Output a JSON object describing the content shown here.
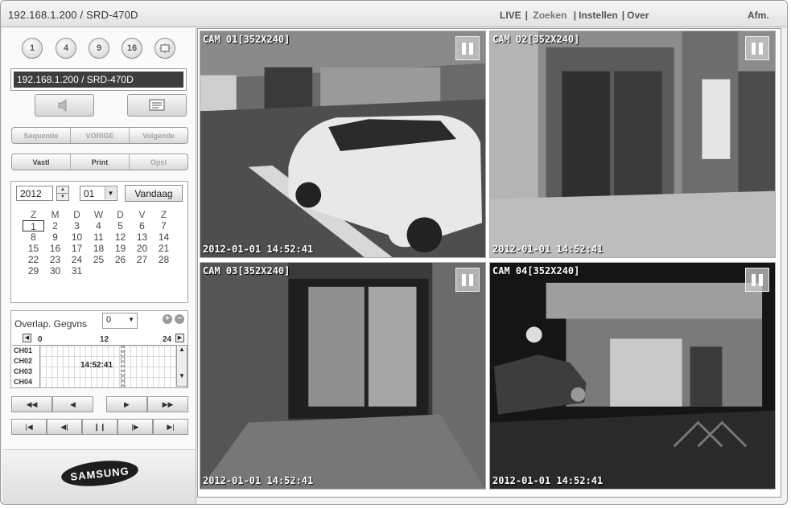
{
  "header": {
    "title": "192.168.1.200 / SRD-470D",
    "nav": {
      "live": "LIVE",
      "search": "Zoeken",
      "settings": "Instellen",
      "about": "Over"
    },
    "logout": "Afm."
  },
  "sidebar": {
    "split_buttons": [
      "1",
      "4",
      "9",
      "16"
    ],
    "device_label": "192.168.1.200   / SRD-470D",
    "seq_bar": [
      "Sequentie",
      "VORIGE",
      "Volgende"
    ],
    "action_bar": [
      "Vastl",
      "Print",
      "Opsl"
    ],
    "calendar": {
      "year": "2012",
      "month": "01",
      "today_label": "Vandaag",
      "weekdays": [
        "Z",
        "M",
        "D",
        "W",
        "D",
        "V",
        "Z"
      ],
      "weeks": [
        [
          "1",
          "2",
          "3",
          "4",
          "5",
          "6",
          "7"
        ],
        [
          "8",
          "9",
          "10",
          "11",
          "12",
          "13",
          "14"
        ],
        [
          "15",
          "16",
          "17",
          "18",
          "19",
          "20",
          "21"
        ],
        [
          "22",
          "23",
          "24",
          "25",
          "26",
          "27",
          "28"
        ],
        [
          "29",
          "30",
          "31",
          "",
          "",
          "",
          ""
        ]
      ],
      "selected_day": "1"
    },
    "overlap": {
      "label": "Overlap. Gegvns",
      "value": "0",
      "ticks": [
        "0",
        "12",
        "24"
      ],
      "channels": [
        "CH01",
        "CH02",
        "CH03",
        "CH04"
      ],
      "cursor_time": "14:52:41"
    },
    "brand": "SAMSUNG"
  },
  "cameras": [
    {
      "caption": "CAM 01[352X240]",
      "timestamp": "2012-01-01  14:52:41"
    },
    {
      "caption": "CAM 02[352X240]",
      "timestamp": "2012-01-01  14:52:41"
    },
    {
      "caption": "CAM 03[352X240]",
      "timestamp": "2012-01-01  14:52:41"
    },
    {
      "caption": "CAM 04[352X240]",
      "timestamp": "2012-01-01  14:52:41"
    }
  ],
  "colors": {
    "panel": "#fafafa",
    "device_bar": "#3d3d3d",
    "logo": "#1d1d1d"
  }
}
